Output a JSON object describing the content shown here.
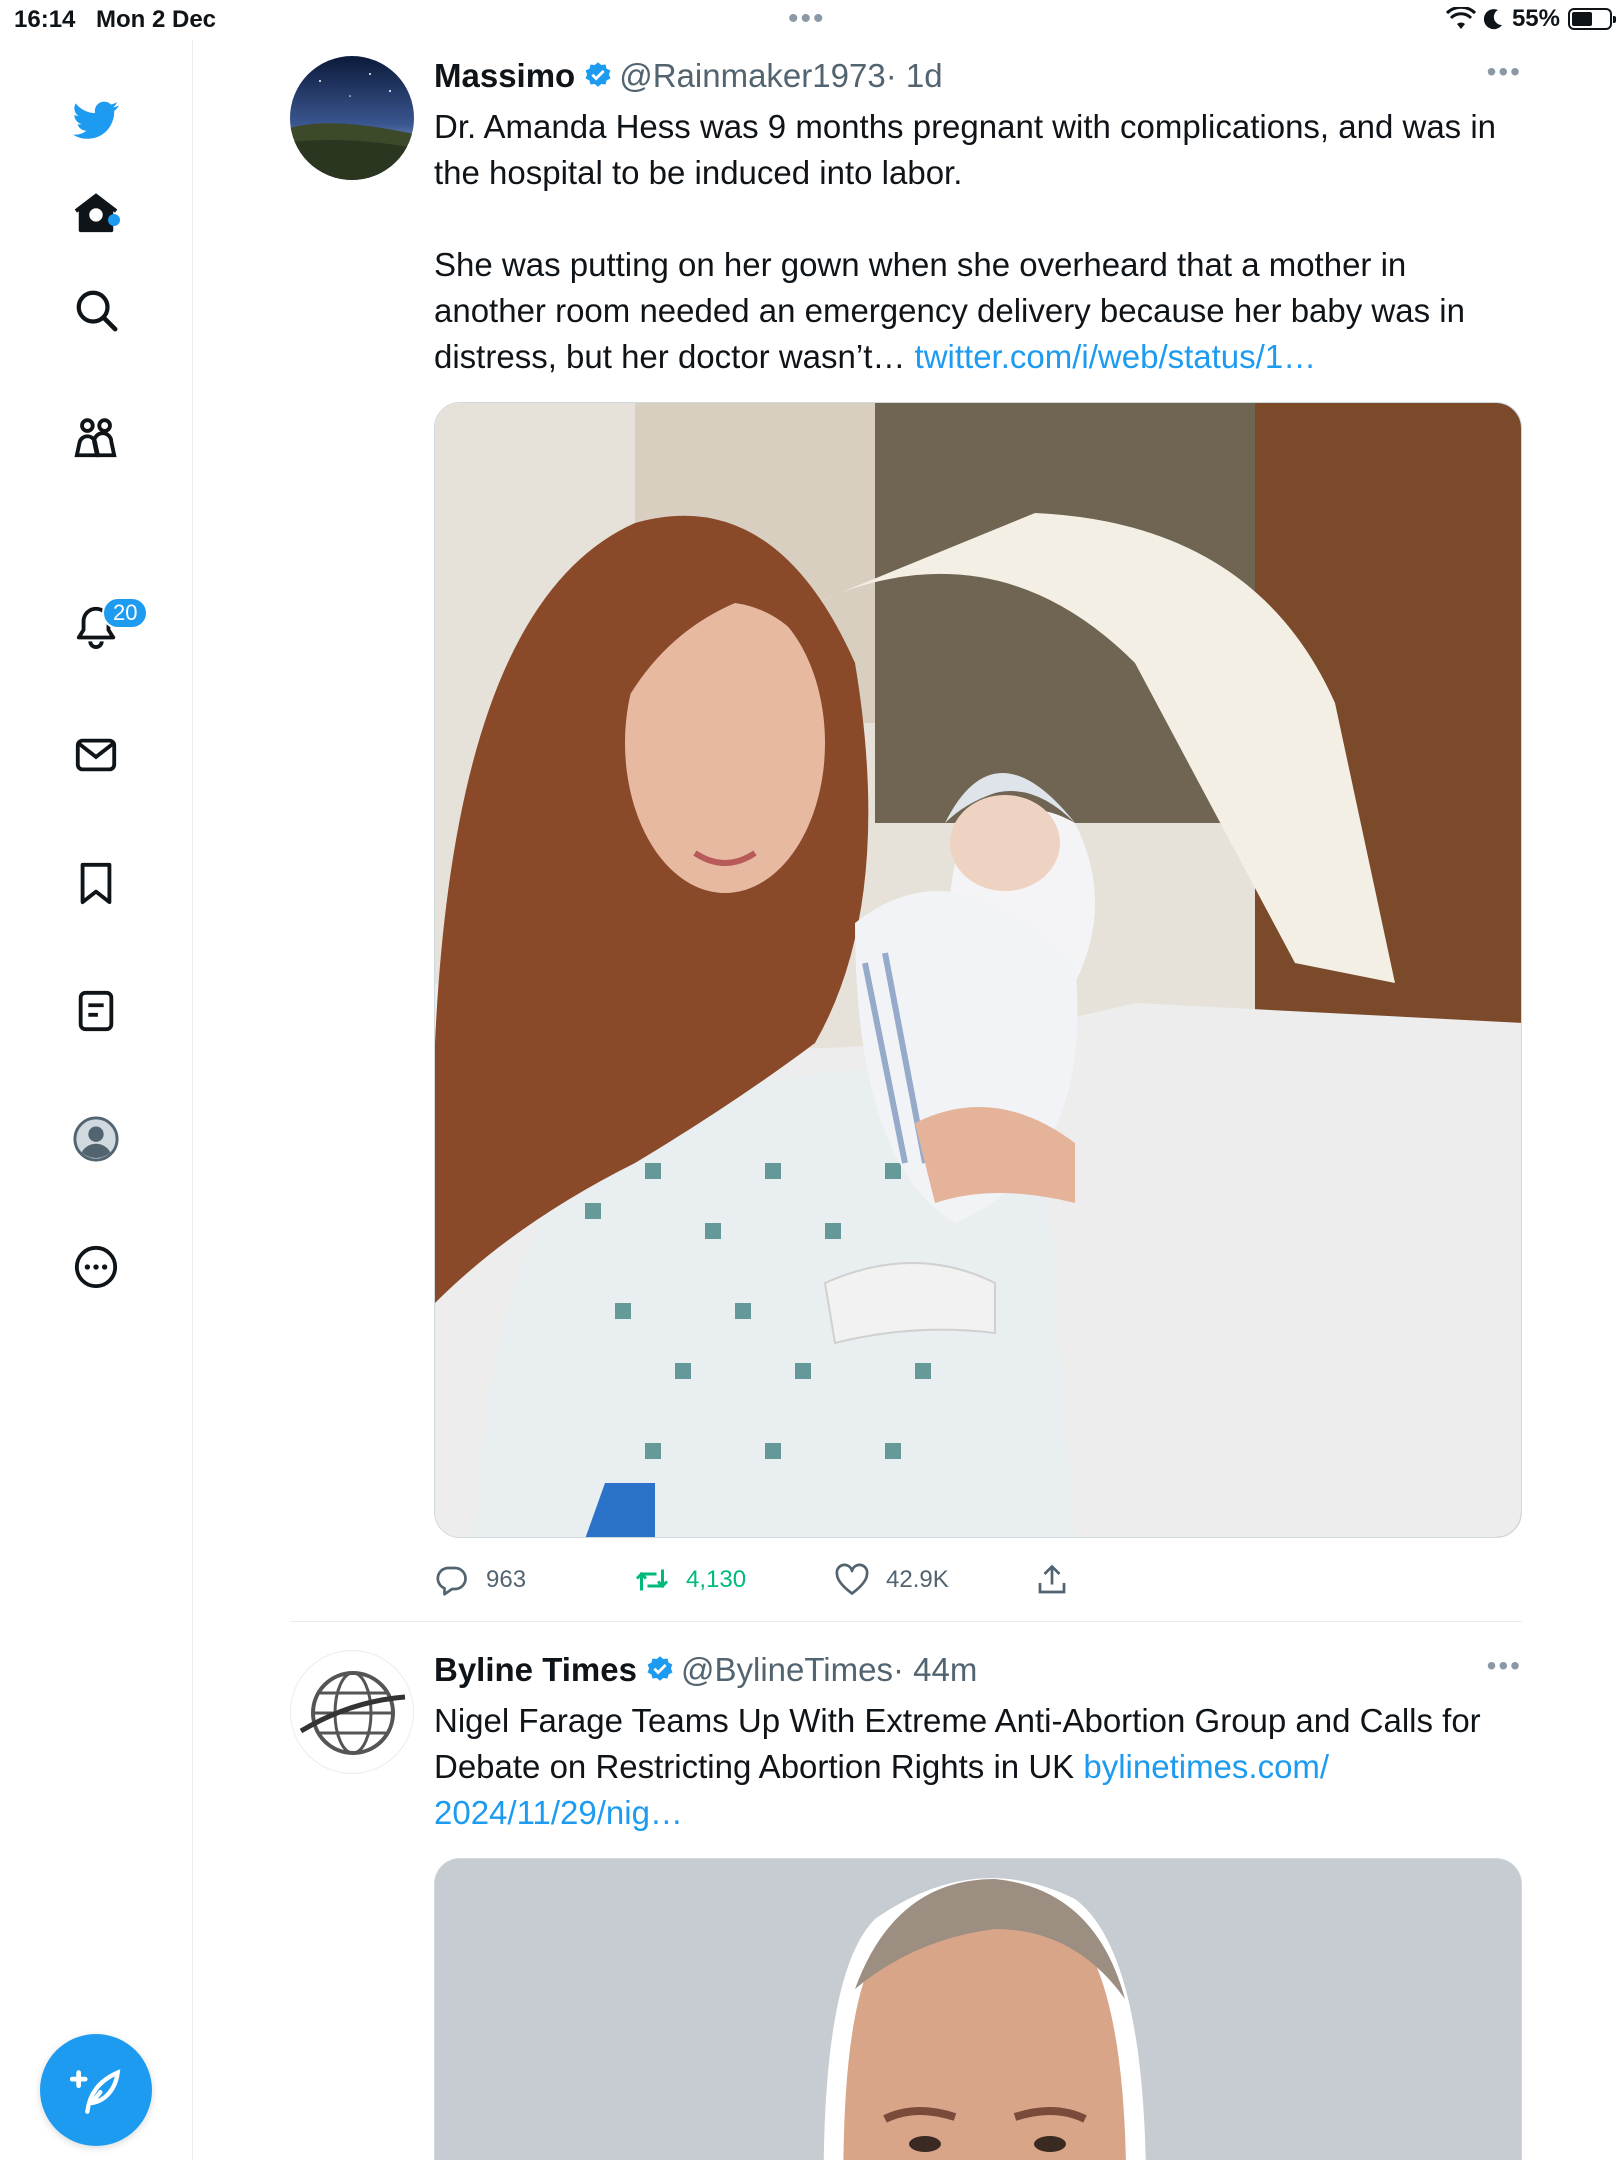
{
  "status_bar": {
    "time": "16:14",
    "date": "Mon 2 Dec",
    "battery": "55%",
    "battery_level": 0.55
  },
  "sidebar": {
    "notifications_badge": "20",
    "icons": [
      "twitter-logo-icon",
      "home-icon",
      "search-icon",
      "communities-icon",
      "notifications-icon",
      "messages-icon",
      "bookmarks-icon",
      "lists-icon",
      "profile-icon",
      "more-icon"
    ]
  },
  "colors": {
    "accent": "#1d9bf0",
    "text": "#0f1419",
    "muted": "#536471",
    "retweet_green": "#00ba7c"
  },
  "tweets": [
    {
      "name": "Massimo",
      "handle": "@Rainmaker1973",
      "time": "· 1d",
      "text_p1": "Dr. Amanda Hess was 9 months pregnant with complications, and was in the hospital to be induced into labor.",
      "text_p2": "She was putting on her gown when she overheard that a mother in another room needed an emergency delivery because her baby was in distress, but her doctor wasn’t… ",
      "link": "twitter.com/i/web/status/1…",
      "replies": "963",
      "retweets": "4,130",
      "likes": "42.9K"
    },
    {
      "name": "Byline Times",
      "handle": "@BylineTimes",
      "time": "· 44m",
      "text": "Nigel Farage Teams Up With Extreme Anti-Abortion Group and Calls for Debate on Restricting Abortion Rights in UK ",
      "link": "bylinetimes.com/ 2024/11/29/nig…"
    }
  ]
}
